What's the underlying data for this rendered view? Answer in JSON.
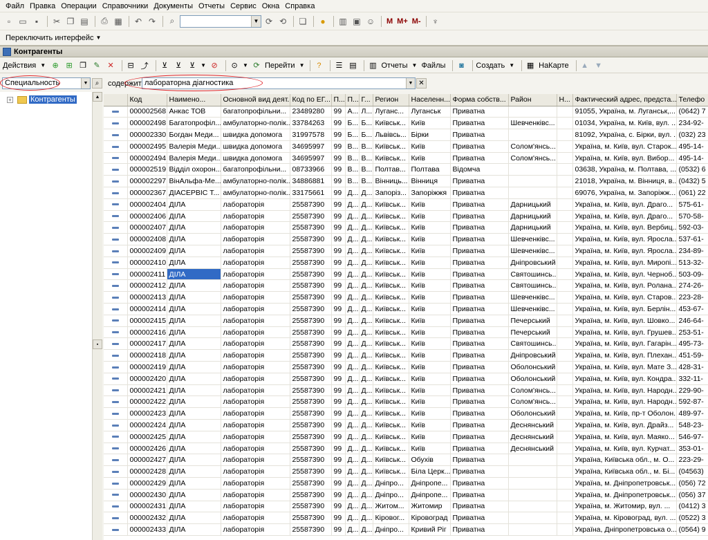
{
  "menu": [
    "Файл",
    "Правка",
    "Операции",
    "Справочники",
    "Документы",
    "Отчеты",
    "Сервис",
    "Окна",
    "Справка"
  ],
  "toolbar": {
    "m_label": "M",
    "mplus_label": "M+",
    "mminus_label": "M-",
    "switch_interface": "Переключить интерфейс"
  },
  "window": {
    "title": "Контрагенты"
  },
  "actions": {
    "actions_label": "Действия",
    "goto_label": "Перейти",
    "reports_label": "Отчеты",
    "files_label": "Файлы",
    "create_label": "Создать",
    "map_label": "НаКарте"
  },
  "filter": {
    "field": "Специальность",
    "contains_label": "содержит:",
    "value": "лабораторна діагностика"
  },
  "tree": {
    "root": "Контрагенты"
  },
  "grid": {
    "columns": [
      "",
      "Код",
      "Наимено...",
      "Основной вид деят...",
      "Код по ЕГ...",
      "П...",
      "П...",
      "Г...",
      "Регион",
      "Населенн...",
      "Форма собств...",
      "Район",
      "Н...",
      "Фактический адрес, предста...",
      "Телефо"
    ],
    "selected_row": 14,
    "selected_col": 2,
    "rows": [
      [
        "",
        "000002568",
        "Анкас ТОВ",
        "багатопрофільни...",
        "23489280",
        "99",
        "А...",
        "Л...",
        "Луганс...",
        "Луганськ",
        "Приватна",
        "",
        "",
        "91055, Україна, м. Луганськ,...",
        "(0642) 7"
      ],
      [
        "",
        "000002498",
        "Багатопрофіл...",
        "амбулаторно-полік...",
        "33784263",
        "99",
        "Б...",
        "Б...",
        "Київськ...",
        "Київ",
        "Приватна",
        "Шевченківс...",
        "",
        "01034, Україна, м. Київ, вул. ...",
        "234-92-"
      ],
      [
        "",
        "000002330",
        "Богдан Меди...",
        "швидка допомога",
        "31997578",
        "99",
        "Б...",
        "Б...",
        "Львівсь...",
        "Бірки",
        "Приватна",
        "",
        "",
        "81092, Україна, с. Бірки, вул. ...",
        "(032) 23"
      ],
      [
        "",
        "000002495",
        "Валерія Меди...",
        "швидка допомога",
        "34695997",
        "99",
        "В...",
        "В...",
        "Київськ...",
        "Київ",
        "Приватна",
        "Солом'янсь...",
        "",
        "Україна, м. Київ, вул. Старок...",
        "495-14-"
      ],
      [
        "",
        "000002494",
        "Валерія Меди...",
        "швидка допомога",
        "34695997",
        "99",
        "В...",
        "В...",
        "Київськ...",
        "Київ",
        "Приватна",
        "Солом'янсь...",
        "",
        "Україна, м. Київ, вул. Вибор...",
        "495-14-"
      ],
      [
        "",
        "000002519",
        "Відділ охорон...",
        "багатопрофільни...",
        "08733966",
        "99",
        "В...",
        "В...",
        "Полтав...",
        "Полтава",
        "Відомча",
        "",
        "",
        "03638, Україна, м. Полтава, ...",
        "(0532) 6"
      ],
      [
        "",
        "000002297",
        "ВінАльфа-Ме...",
        "амбулаторно-полік...",
        "34886881",
        "99",
        "В...",
        "В...",
        "Вінниць...",
        "Вінниця",
        "Приватна",
        "",
        "",
        "21018, Україна, м. Вінниця, в...",
        "(0432) 5"
      ],
      [
        "",
        "000002367",
        "ДІАСЕРВІС Т...",
        "амбулаторно-полік...",
        "33175661",
        "99",
        "Д...",
        "Д...",
        "Запоріз...",
        "Запоріжжя",
        "Приватна",
        "",
        "",
        "69076, Україна, м. Запоріжж...",
        "(061) 22"
      ],
      [
        "",
        "000002404",
        "ДІЛА",
        "лабораторія",
        "25587390",
        "99",
        "Д...",
        "Д...",
        "Київськ...",
        "Київ",
        "Приватна",
        "Дарницький",
        "",
        "Україна, м. Київ, вул. Драго...",
        "575-61-"
      ],
      [
        "",
        "000002406",
        "ДІЛА",
        "лабораторія",
        "25587390",
        "99",
        "Д...",
        "Д...",
        "Київськ...",
        "Київ",
        "Приватна",
        "Дарницький",
        "",
        "Україна, м. Київ, вул. Драго...",
        "570-58-"
      ],
      [
        "",
        "000002407",
        "ДІЛА",
        "лабораторія",
        "25587390",
        "99",
        "Д...",
        "Д...",
        "Київськ...",
        "Київ",
        "Приватна",
        "Дарницький",
        "",
        "Україна, м. Київ, вул. Вербиц...",
        "592-03-"
      ],
      [
        "",
        "000002408",
        "ДІЛА",
        "лабораторія",
        "25587390",
        "99",
        "Д...",
        "Д...",
        "Київськ...",
        "Київ",
        "Приватна",
        "Шевченківс...",
        "",
        "Україна, м. Київ, вул. Яросла...",
        "537-61-"
      ],
      [
        "",
        "000002409",
        "ДІЛА",
        "лабораторія",
        "25587390",
        "99",
        "Д...",
        "Д...",
        "Київськ...",
        "Київ",
        "Приватна",
        "Шевченківс...",
        "",
        "Україна, м. Київ, вул. Яросла...",
        "234-89-"
      ],
      [
        "",
        "000002410",
        "ДІЛА",
        "лабораторія",
        "25587390",
        "99",
        "Д...",
        "Д...",
        "Київськ...",
        "Київ",
        "Приватна",
        "Дніпровський",
        "",
        "Україна, м. Київ, вул. Миропі...",
        "513-32-"
      ],
      [
        "",
        "000002411",
        "ДІЛА",
        "лабораторія",
        "25587390",
        "99",
        "Д...",
        "Д...",
        "Київськ...",
        "Київ",
        "Приватна",
        "Святошинсь...",
        "",
        "Україна, м. Київ, вул. Черноб...",
        "503-09-"
      ],
      [
        "",
        "000002412",
        "ДІЛА",
        "лабораторія",
        "25587390",
        "99",
        "Д...",
        "Д...",
        "Київськ...",
        "Київ",
        "Приватна",
        "Святошинсь...",
        "",
        "Україна, м. Київ, вул. Роланa...",
        "274-26-"
      ],
      [
        "",
        "000002413",
        "ДІЛА",
        "лабораторія",
        "25587390",
        "99",
        "Д...",
        "Д...",
        "Київськ...",
        "Київ",
        "Приватна",
        "Шевченківс...",
        "",
        "Україна, м. Київ, вул. Старов...",
        "223-28-"
      ],
      [
        "",
        "000002414",
        "ДІЛА",
        "лабораторія",
        "25587390",
        "99",
        "Д...",
        "Д...",
        "Київськ...",
        "Київ",
        "Приватна",
        "Шевченківс...",
        "",
        "Україна, м. Київ, вул. Берлін...",
        "453-67-"
      ],
      [
        "",
        "000002415",
        "ДІЛА",
        "лабораторія",
        "25587390",
        "99",
        "Д...",
        "Д...",
        "Київськ...",
        "Київ",
        "Приватна",
        "Печерський",
        "",
        "Україна, м. Київ, вул. Шовко...",
        "246-64-"
      ],
      [
        "",
        "000002416",
        "ДІЛА",
        "лабораторія",
        "25587390",
        "99",
        "Д...",
        "Д...",
        "Київськ...",
        "Київ",
        "Приватна",
        "Печерський",
        "",
        "Україна, м. Київ, вул. Грушев...",
        "253-51-"
      ],
      [
        "",
        "000002417",
        "ДІЛА",
        "лабораторія",
        "25587390",
        "99",
        "Д...",
        "Д...",
        "Київськ...",
        "Київ",
        "Приватна",
        "Святошинсь...",
        "",
        "Україна, м. Київ, вул. Гагарін...",
        "495-73-"
      ],
      [
        "",
        "000002418",
        "ДІЛА",
        "лабораторія",
        "25587390",
        "99",
        "Д...",
        "Д...",
        "Київськ...",
        "Київ",
        "Приватна",
        "Дніпровський",
        "",
        "Україна, м. Київ, вул. Плехан...",
        "451-59-"
      ],
      [
        "",
        "000002419",
        "ДІЛА",
        "лабораторія",
        "25587390",
        "99",
        "Д...",
        "Д...",
        "Київськ...",
        "Київ",
        "Приватна",
        "Оболонський",
        "",
        "Україна, м. Київ, вул. Мате З...",
        "428-31-"
      ],
      [
        "",
        "000002420",
        "ДІЛА",
        "лабораторія",
        "25587390",
        "99",
        "Д...",
        "Д...",
        "Київськ...",
        "Київ",
        "Приватна",
        "Оболонський",
        "",
        "Україна, м. Київ, вул. Кондра...",
        "332-11-"
      ],
      [
        "",
        "000002421",
        "ДІЛА",
        "лабораторія",
        "25587390",
        "99",
        "Д...",
        "Д...",
        "Київськ...",
        "Київ",
        "Приватна",
        "Солом'янсь...",
        "",
        "Україна, м. Київ, вул. Народн...",
        "229-90-"
      ],
      [
        "",
        "000002422",
        "ДІЛА",
        "лабораторія",
        "25587390",
        "99",
        "Д...",
        "Д...",
        "Київськ...",
        "Київ",
        "Приватна",
        "Солом'янсь...",
        "",
        "Україна, м. Київ, вул. Народн...",
        "592-87-"
      ],
      [
        "",
        "000002423",
        "ДІЛА",
        "лабораторія",
        "25587390",
        "99",
        "Д...",
        "Д...",
        "Київськ...",
        "Київ",
        "Приватна",
        "Оболонський",
        "",
        "Україна, м. Київ, пр-т Оболон...",
        "489-97-"
      ],
      [
        "",
        "000002424",
        "ДІЛА",
        "лабораторія",
        "25587390",
        "99",
        "Д...",
        "Д...",
        "Київськ...",
        "Київ",
        "Приватна",
        "Деснянський",
        "",
        "Україна, м. Київ, вул. Драйз...",
        "548-23-"
      ],
      [
        "",
        "000002425",
        "ДІЛА",
        "лабораторія",
        "25587390",
        "99",
        "Д...",
        "Д...",
        "Київськ...",
        "Київ",
        "Приватна",
        "Деснянський",
        "",
        "Україна, м. Київ, вул. Маяко...",
        "546-97-"
      ],
      [
        "",
        "000002426",
        "ДІЛА",
        "лабораторія",
        "25587390",
        "99",
        "Д...",
        "Д...",
        "Київськ...",
        "Київ",
        "Приватна",
        "Деснянський",
        "",
        "Україна, м. Київ, вул. Курчат...",
        "353-01-"
      ],
      [
        "",
        "000002427",
        "ДІЛА",
        "лабораторія",
        "25587390",
        "99",
        "Д...",
        "Д...",
        "Київськ...",
        "Обухів",
        "Приватна",
        "",
        "",
        "Україна, Київська обл., м. О...",
        "223-29-"
      ],
      [
        "",
        "000002428",
        "ДІЛА",
        "лабораторія",
        "25587390",
        "99",
        "Д...",
        "Д...",
        "Київськ...",
        "Біла Церк...",
        "Приватна",
        "",
        "",
        "Україна, Київська обл., м. Бі...",
        "(04563)"
      ],
      [
        "",
        "000002429",
        "ДІЛА",
        "лабораторія",
        "25587390",
        "99",
        "Д...",
        "Д...",
        "Дніпро...",
        "Дніпропе...",
        "Приватна",
        "",
        "",
        "Україна, м. Дніпропетровськ...",
        "(056) 72"
      ],
      [
        "",
        "000002430",
        "ДІЛА",
        "лабораторія",
        "25587390",
        "99",
        "Д...",
        "Д...",
        "Дніпро...",
        "Дніпропе...",
        "Приватна",
        "",
        "",
        "Україна, м. Дніпропетровськ...",
        "(056) 37"
      ],
      [
        "",
        "000002431",
        "ДІЛА",
        "лабораторія",
        "25587390",
        "99",
        "Д...",
        "Д...",
        "Житом...",
        "Житомир",
        "Приватна",
        "",
        "",
        "Україна, м. Житомир, вул. ...",
        "(0412) 3"
      ],
      [
        "",
        "000002432",
        "ДІЛА",
        "лабораторія",
        "25587390",
        "99",
        "Д...",
        "Д...",
        "Кіровог...",
        "Кіровоград",
        "Приватна",
        "",
        "",
        "Україна, м. Кіровоград, вул. ...",
        "(0522) 3"
      ],
      [
        "",
        "000002433",
        "ДІЛА",
        "лабораторія",
        "25587390",
        "99",
        "Д...",
        "Д...",
        "Дніпро...",
        "Кривий Ріг",
        "Приватна",
        "",
        "",
        "Україна, Дніпропетровська о...",
        "(0564) 9"
      ]
    ]
  }
}
